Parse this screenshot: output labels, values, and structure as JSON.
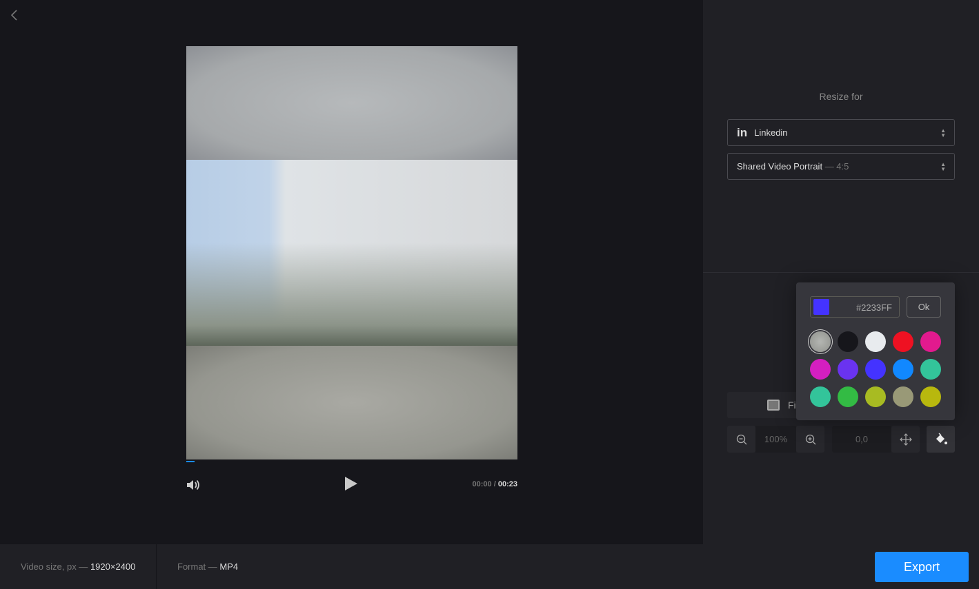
{
  "player": {
    "current_time": "00:00",
    "separator": "/",
    "duration": "00:23",
    "progress_fraction": 0.0
  },
  "side": {
    "resize_label": "Resize for",
    "platform": {
      "icon": "in",
      "label": "Linkedin"
    },
    "preset": {
      "label": "Shared Video Portrait",
      "ratio": "— 4:5"
    },
    "fill_label": "Fill",
    "zoom_value": "100%",
    "position_value": "0,0"
  },
  "color_picker": {
    "hex_value": "#2233FF",
    "ok_label": "Ok",
    "swatches": [
      "blur",
      "#16161b",
      "#e8ebee",
      "#ee1122",
      "#e21a8e",
      "#d41fc0",
      "#6a33f0",
      "#4433ff",
      "#1188ff",
      "#33c49a",
      "#33c49a",
      "#33bb44",
      "#a8bb22",
      "#999977",
      "#b8b80e"
    ]
  },
  "footer": {
    "size_label": "Video size, px —",
    "size_value": "1920×2400",
    "format_label": "Format —",
    "format_value": "MP4",
    "export_label": "Export"
  },
  "colors": {
    "accent": "#1a8cff"
  }
}
